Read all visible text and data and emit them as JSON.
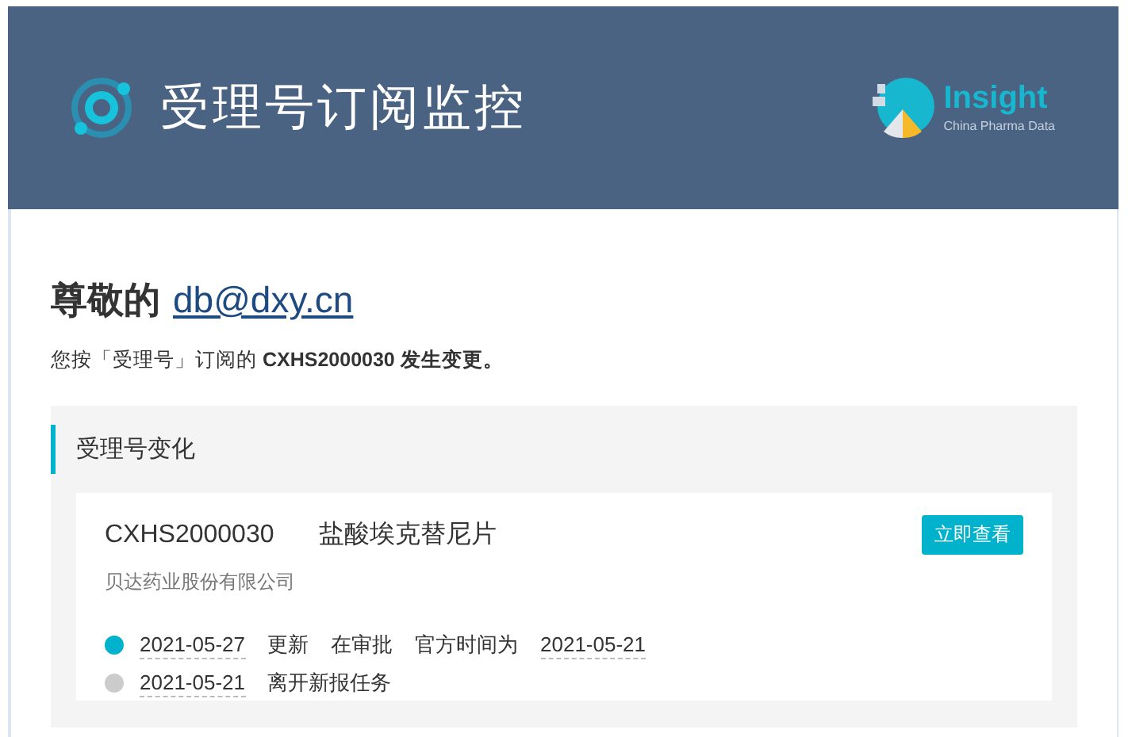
{
  "header": {
    "title": "受理号订阅监控",
    "brand": {
      "name": "Insight",
      "tagline": "China Pharma Data"
    }
  },
  "greeting": {
    "label": "尊敬的",
    "email": "db@dxy.cn"
  },
  "intro": "您按「受理号」订阅的 **CXHS2000030 发生变更。**",
  "section": {
    "title": "受理号变化",
    "card": {
      "number": "CXHS2000030",
      "drug": "盐酸埃克替尼片",
      "company": "贝达药业股份有限公司",
      "button": "立即查看",
      "events": [
        {
          "color": "#00b2cc",
          "parts": [
            {
              "kind": "date",
              "text": "2021-05-27"
            },
            {
              "kind": "text",
              "text": "更新"
            },
            {
              "kind": "text",
              "text": "在审批"
            },
            {
              "kind": "text",
              "text": "官方时间为"
            },
            {
              "kind": "date",
              "text": "2021-05-21"
            }
          ]
        },
        {
          "color": "#cccccc",
          "parts": [
            {
              "kind": "date",
              "text": "2021-05-21"
            },
            {
              "kind": "text",
              "text": "离开新报任务"
            }
          ]
        }
      ]
    }
  }
}
